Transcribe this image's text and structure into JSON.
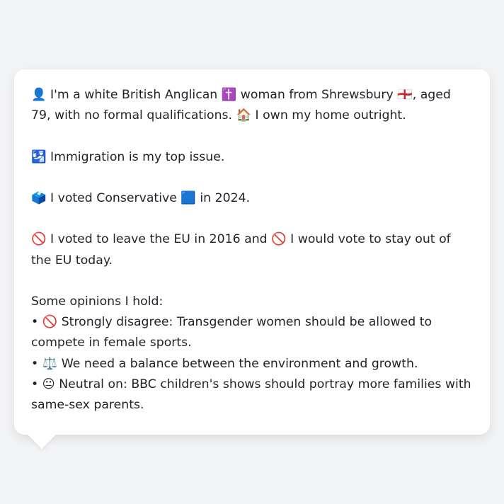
{
  "profile": {
    "line1": "👤 I'm a white British Anglican ✝️ woman from Shrewsbury 🏴󠁧󠁢󠁥󠁮󠁧󠁿, aged 79, with no formal qualifications. 🏠 I own my home outright.",
    "issue": "🛂 Immigration is my top issue.",
    "vote2024": "🗳️ I voted Conservative 🟦 in 2024.",
    "eu": "🚫 I voted to leave the EU in 2016 and 🚫 I would vote to stay out of the EU today."
  },
  "opinions": {
    "heading": "Some opinions I hold:",
    "items": [
      "• 🚫 Strongly disagree: Transgender women should be allowed to compete in female sports.",
      "• ⚖️ We need a balance between the environment and growth.",
      "• 😐 Neutral on: BBC children's shows should portray more families with same-sex parents."
    ]
  },
  "colors": {
    "background": "#f2f3f5",
    "card": "#ffffff",
    "text": "#1e2329"
  }
}
